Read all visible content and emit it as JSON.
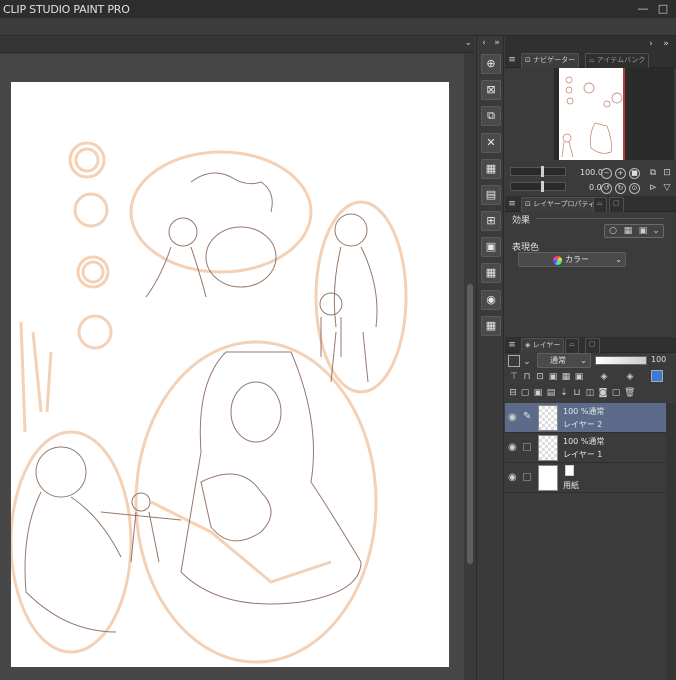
{
  "app": {
    "title": "CLIP STUDIO PAINT PRO"
  },
  "window": {
    "minimize": "—",
    "restore": "□"
  },
  "canvas_tab": {
    "dropdown_icon": "chevron-down-icon"
  },
  "tools": {
    "items": [
      "zoom-tool-icon",
      "clear-layer-icon",
      "copy-icon",
      "delete-icon",
      "select-all-icon",
      "paste-icon",
      "transform-icon",
      "layer-folder-icon",
      "grid-icon",
      "camera-icon",
      "grid-icon"
    ]
  },
  "navigator": {
    "tab_label": "ナビゲーター",
    "tab2_label": "アイテムバンク",
    "zoom_value": "100.0",
    "rotate_value": "0.0",
    "frame_color": "#b23b3b"
  },
  "layer_property": {
    "tab_label": "レイヤープロパティ",
    "effect_label": "効果",
    "express_color_label": "表現色",
    "color_mode": "カラー"
  },
  "layers": {
    "tab_label": "レイヤー",
    "blend_mode": "通常",
    "opacity": "100",
    "items": [
      {
        "line1": "100 %通常",
        "line2": "レイヤー 2",
        "selected": true
      },
      {
        "line1": "100 %通常",
        "line2": "レイヤー 1",
        "selected": false
      },
      {
        "line1": "",
        "line2": "用紙",
        "selected": false
      }
    ]
  },
  "colors": {
    "selected_layer": "#5d6b8a",
    "sketch_orange": "#f3c8a8",
    "sketch_line": "#8a6a5a"
  }
}
